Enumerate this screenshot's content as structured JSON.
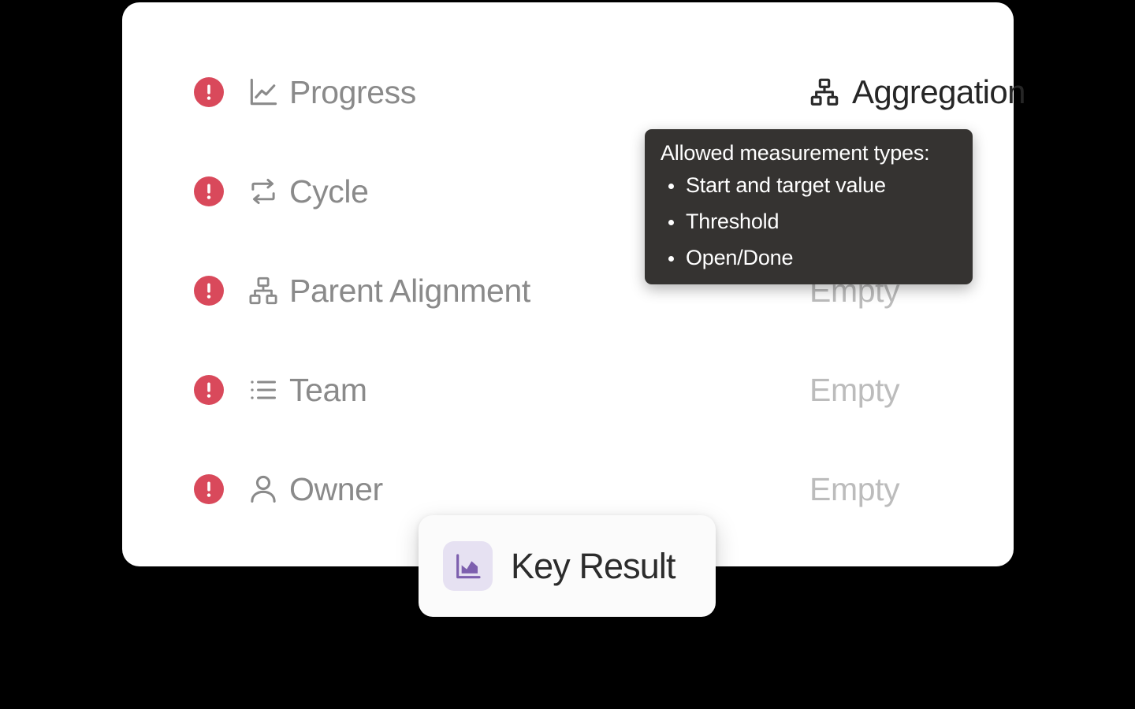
{
  "card": {
    "fields": [
      {
        "name": "progress",
        "icon": "line-chart-icon",
        "label": "Progress",
        "status": "error",
        "value": ""
      },
      {
        "name": "cycle",
        "icon": "repeat-cycle-icon",
        "label": "Cycle",
        "status": "error",
        "value": ""
      },
      {
        "name": "parent-alignment",
        "icon": "hierarchy-icon",
        "label": "Parent Alignment",
        "status": "error",
        "value": "Empty"
      },
      {
        "name": "team",
        "icon": "list-icon",
        "label": "Team",
        "status": "error",
        "value": "Empty"
      },
      {
        "name": "owner",
        "icon": "user-icon",
        "label": "Owner",
        "status": "error",
        "value": "Empty"
      }
    ],
    "aggregation": {
      "icon": "hierarchy-icon",
      "label": "Aggregation"
    }
  },
  "tooltip": {
    "title": "Allowed measurement types:",
    "items": [
      "Start and target value",
      "Threshold",
      "Open/Done"
    ]
  },
  "key_result_badge": {
    "icon": "area-chart-icon",
    "label": "Key Result"
  },
  "colors": {
    "background": "#000000",
    "card": "#ffffff",
    "alert": "#d9495b",
    "label": "#8a8a8a",
    "value_placeholder": "#bcbcbc",
    "tooltip_bg": "#353331",
    "tooltip_text": "#ffffff",
    "accent_purple": "#7d5fae",
    "accent_purple_bg": "#e6e1f2",
    "heading": "#262626"
  }
}
